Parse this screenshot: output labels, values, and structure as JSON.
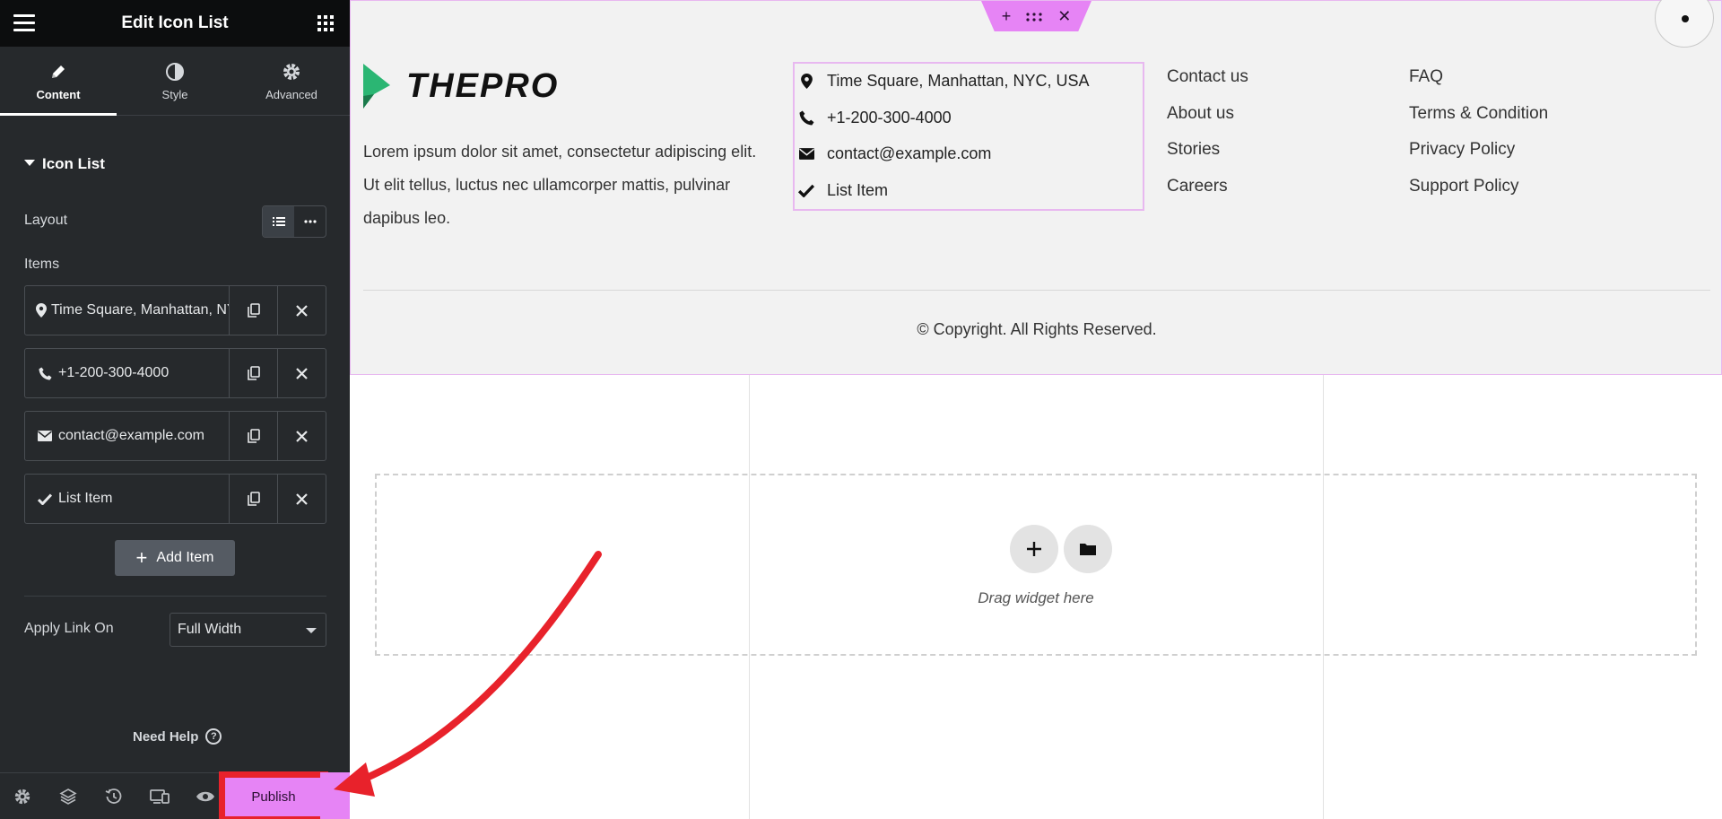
{
  "sidebar": {
    "title": "Edit Icon List",
    "tabs": [
      {
        "label": "Content",
        "icon": "pencil-icon",
        "active": true
      },
      {
        "label": "Style",
        "icon": "contrast-icon",
        "active": false
      },
      {
        "label": "Advanced",
        "icon": "gear-icon",
        "active": false
      }
    ],
    "section_title": "Icon List",
    "layout_label": "Layout",
    "items_label": "Items",
    "items": [
      {
        "label": "Time Square, Manhattan, NYC, USA",
        "icon": "map-pin-icon"
      },
      {
        "label": "+1-200-300-4000",
        "icon": "phone-icon"
      },
      {
        "label": "contact@example.com",
        "icon": "envelope-icon"
      },
      {
        "label": "List Item",
        "icon": "check-icon"
      }
    ],
    "add_item_label": "Add Item",
    "apply_link_label": "Apply Link On",
    "apply_link_value": "Full Width",
    "need_help_label": "Need Help",
    "publish_label": "Publish",
    "colors": {
      "panel": "#26292c",
      "header": "#0c0d0e",
      "accent": "#e684f5",
      "annotation": "#e8222b"
    }
  },
  "canvas": {
    "logo_text": "THEPRO",
    "about_text": "Lorem ipsum dolor sit amet, consectetur adipiscing elit. Ut elit tellus, luctus nec ullamcorper mattis, pulvinar dapibus leo.",
    "contact_items": [
      {
        "text": "Time Square, Manhattan, NYC, USA",
        "icon": "map-pin-icon"
      },
      {
        "text": "+1-200-300-4000",
        "icon": "phone-icon"
      },
      {
        "text": "contact@example.com",
        "icon": "envelope-icon"
      },
      {
        "text": "List Item",
        "icon": "check-icon"
      }
    ],
    "links_col1": [
      "Contact us",
      "About us",
      "Stories",
      "Careers"
    ],
    "links_col2": [
      "FAQ",
      "Terms & Condition",
      "Privacy Policy",
      "Support Policy"
    ],
    "copyright": "© Copyright. All Rights Reserved.",
    "drop_text": "Drag widget here"
  }
}
